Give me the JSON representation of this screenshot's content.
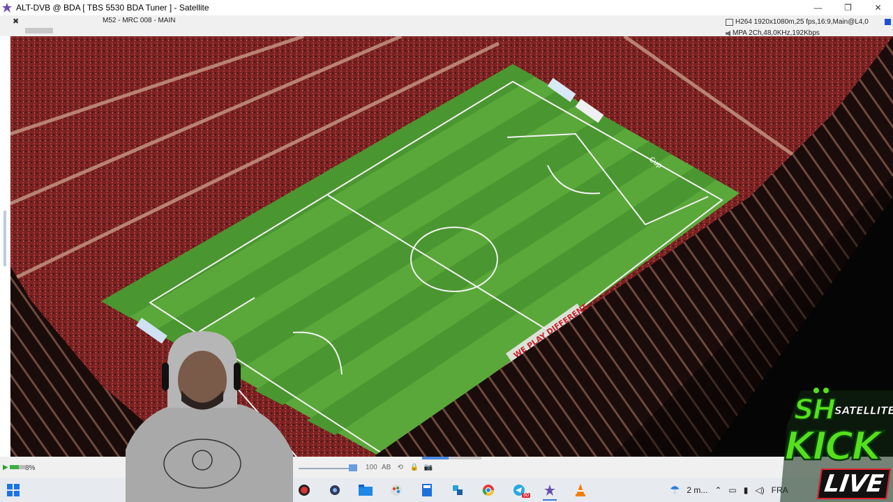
{
  "window": {
    "title": "ALT-DVB @ BDA [ TBS 5530 BDA Tuner ] - Satellite",
    "controls": [
      "—",
      "❐",
      "✕"
    ]
  },
  "infobar": {
    "channel": "M52 - MRC 008 - MAIN",
    "video_info": "H264 1920x1080m,25 fps,16:9,Main@L4,0",
    "audio_info": "MPA 2Ch,48,0KHz,192Kbps"
  },
  "video": {
    "field_banner": "WE PLAY DIFFERENT",
    "board_text": "Cup"
  },
  "player_controls": {
    "zoom": "8%",
    "icons": [
      "100",
      "AB",
      "⟲",
      "🔒",
      "📷"
    ],
    "progress": 0.45
  },
  "taskbar": {
    "apps": [
      "obs-icon",
      "webcam-icon",
      "folder-icon",
      "paint-icon",
      "calculator-icon",
      "network-icon",
      "chrome-icon",
      "telegram-icon",
      "altdvb-icon",
      "vlc-icon"
    ],
    "telegram_badge": "60",
    "weather": "2 m...",
    "language": "FRA"
  },
  "overlay": {
    "brand_sh": "SH",
    "brand_satellite": "SATELLITE",
    "brand_kick": "KICK",
    "brand_live": "LIVE"
  },
  "colors": {
    "pitch_light": "#5aa83a",
    "pitch_dark": "#4a9630",
    "stands": "#8a2a2a",
    "kick_green": "#54e11c",
    "live_red": "#e01e2e"
  }
}
